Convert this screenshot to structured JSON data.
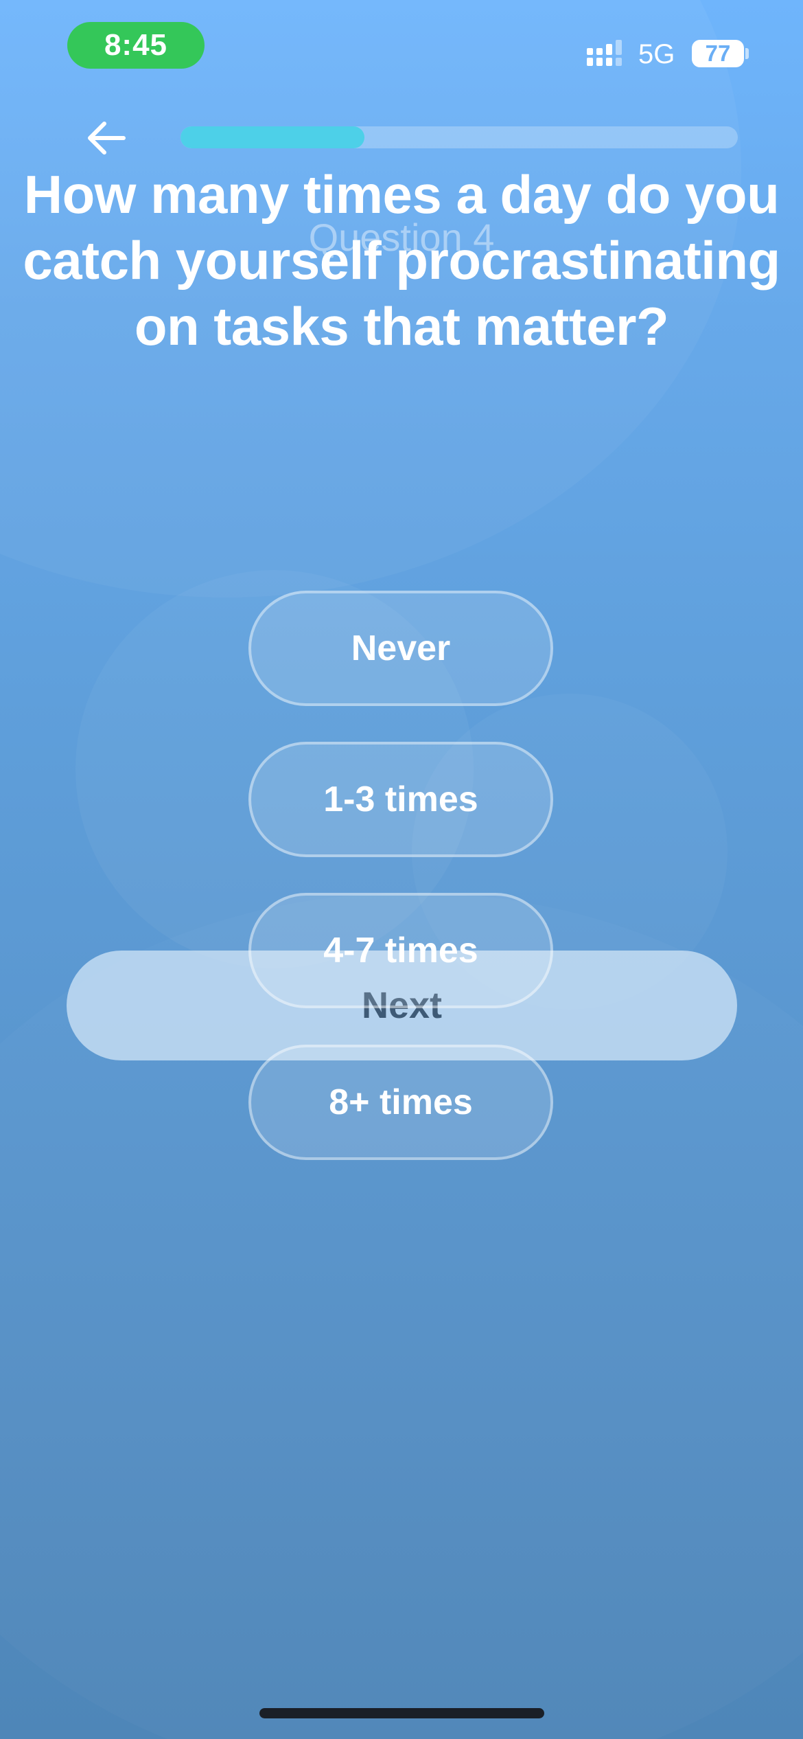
{
  "status_bar": {
    "time": "8:45",
    "network": "5G",
    "battery": "77",
    "battery_level_percent": 77
  },
  "header": {
    "back_icon": "arrow-left-icon",
    "progress_fraction": 0.33
  },
  "question": {
    "title": "How many times a day do you catch yourself procrastinating on tasks that matter?",
    "step": "Question 4"
  },
  "options": [
    "Never",
    "1-3 times",
    "4-7 times",
    "8+ times"
  ],
  "next_label": "Next",
  "colors": {
    "status_time_bg": "#34c759",
    "progress_fill": "#4dd0e8",
    "next_text": "#3e5a76"
  }
}
